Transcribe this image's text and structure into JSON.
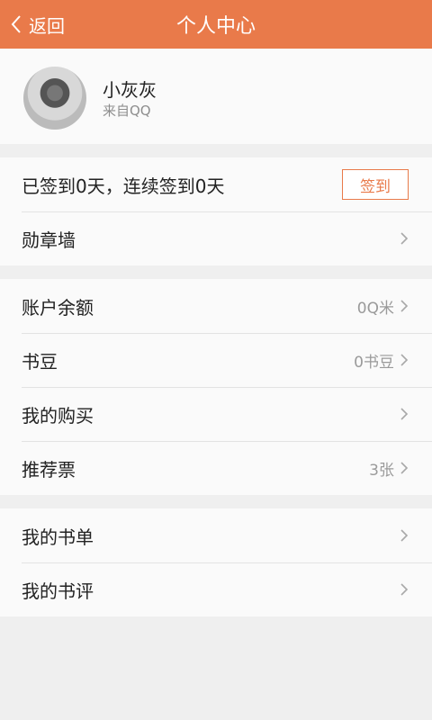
{
  "header": {
    "back_label": "返回",
    "title": "个人中心",
    "accent": "#e97a4a"
  },
  "profile": {
    "username": "小灰灰",
    "source": "来自QQ"
  },
  "checkin": {
    "status": "已签到0天，连续签到0天",
    "button_label": "签到"
  },
  "badges": {
    "label": "勋章墙"
  },
  "account": {
    "items": [
      {
        "label": "账户余额",
        "value": "0Q米"
      },
      {
        "label": "书豆",
        "value": "0书豆"
      },
      {
        "label": "我的购买",
        "value": ""
      },
      {
        "label": "推荐票",
        "value": "3张"
      }
    ]
  },
  "library": {
    "items": [
      {
        "label": "我的书单"
      },
      {
        "label": "我的书评"
      }
    ]
  }
}
